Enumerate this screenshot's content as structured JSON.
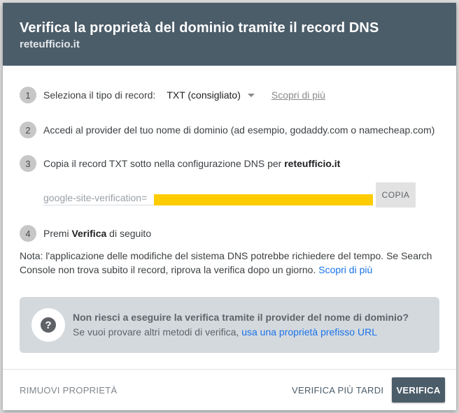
{
  "header": {
    "title": "Verifica la proprietà del dominio tramite il record DNS",
    "subtitle": "reteufficio.it"
  },
  "steps": [
    {
      "num": "1",
      "text": "Seleziona il tipo di record:",
      "select_value": "TXT (consigliato)",
      "link": "Scopri di più"
    },
    {
      "num": "2",
      "text": "Accedi al provider del tuo nome di dominio (ad esempio, godaddy.com o namecheap.com)"
    },
    {
      "num": "3",
      "text": "Copia il record TXT sotto nella configurazione DNS per ",
      "domain": "reteufficio.it"
    },
    {
      "num": "4",
      "text_before": "Premi ",
      "text_bold": "Verifica",
      "text_after": " di seguito"
    }
  ],
  "record": {
    "value": "google-site-verification=",
    "copy_label": "COPIA"
  },
  "note": {
    "text": "Nota: l'applicazione delle modifiche del sistema DNS potrebbe richiedere del tempo. Se Search Console non trova subito il record, riprova la verifica dopo un giorno. ",
    "link": "Scopri di più"
  },
  "help": {
    "title": "Non riesci a eseguire la verifica tramite il provider del nome di dominio?",
    "text": "Se vuoi provare altri metodi di verifica, ",
    "link": "usa una proprietà prefisso URL",
    "icon": "help-icon"
  },
  "footer": {
    "remove_label": "RIMUOVI PROPRIETÀ",
    "later_label": "VERIFICA PIÙ TARDI",
    "verify_label": "VERIFICA"
  },
  "colors": {
    "header_bg": "#4c5d6a",
    "link": "#1a73e8",
    "redaction": "#ffcc00",
    "help_bg": "#d4d9de"
  }
}
